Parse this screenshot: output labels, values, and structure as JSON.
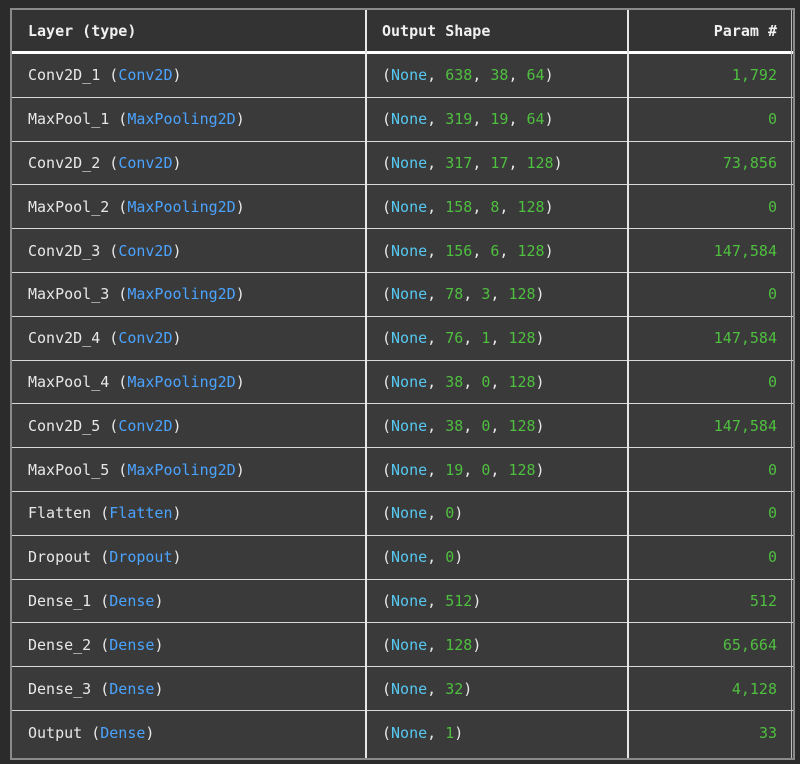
{
  "header": {
    "layer": "Layer (type)",
    "shape": "Output Shape",
    "param": "Param #"
  },
  "rows": [
    {
      "name": "Conv2D_1",
      "type": "Conv2D",
      "shape": [
        "None",
        "638",
        "38",
        "64"
      ],
      "params": "1,792"
    },
    {
      "name": "MaxPool_1",
      "type": "MaxPooling2D",
      "shape": [
        "None",
        "319",
        "19",
        "64"
      ],
      "params": "0"
    },
    {
      "name": "Conv2D_2",
      "type": "Conv2D",
      "shape": [
        "None",
        "317",
        "17",
        "128"
      ],
      "params": "73,856"
    },
    {
      "name": "MaxPool_2",
      "type": "MaxPooling2D",
      "shape": [
        "None",
        "158",
        "8",
        "128"
      ],
      "params": "0"
    },
    {
      "name": "Conv2D_3",
      "type": "Conv2D",
      "shape": [
        "None",
        "156",
        "6",
        "128"
      ],
      "params": "147,584"
    },
    {
      "name": "MaxPool_3",
      "type": "MaxPooling2D",
      "shape": [
        "None",
        "78",
        "3",
        "128"
      ],
      "params": "0"
    },
    {
      "name": "Conv2D_4",
      "type": "Conv2D",
      "shape": [
        "None",
        "76",
        "1",
        "128"
      ],
      "params": "147,584"
    },
    {
      "name": "MaxPool_4",
      "type": "MaxPooling2D",
      "shape": [
        "None",
        "38",
        "0",
        "128"
      ],
      "params": "0"
    },
    {
      "name": "Conv2D_5",
      "type": "Conv2D",
      "shape": [
        "None",
        "38",
        "0",
        "128"
      ],
      "params": "147,584"
    },
    {
      "name": "MaxPool_5",
      "type": "MaxPooling2D",
      "shape": [
        "None",
        "19",
        "0",
        "128"
      ],
      "params": "0"
    },
    {
      "name": "Flatten",
      "type": "Flatten",
      "shape": [
        "None",
        "0"
      ],
      "params": "0"
    },
    {
      "name": "Dropout",
      "type": "Dropout",
      "shape": [
        "None",
        "0"
      ],
      "params": "0"
    },
    {
      "name": "Dense_1",
      "type": "Dense",
      "shape": [
        "None",
        "512"
      ],
      "params": "512"
    },
    {
      "name": "Dense_2",
      "type": "Dense",
      "shape": [
        "None",
        "128"
      ],
      "params": "65,664"
    },
    {
      "name": "Dense_3",
      "type": "Dense",
      "shape": [
        "None",
        "32"
      ],
      "params": "4,128"
    },
    {
      "name": "Output",
      "type": "Dense",
      "shape": [
        "None",
        "1"
      ],
      "params": "33"
    }
  ],
  "colors": {
    "type": "#4aa3ff",
    "none": "#56c8f2",
    "number": "#4fbf3f"
  }
}
